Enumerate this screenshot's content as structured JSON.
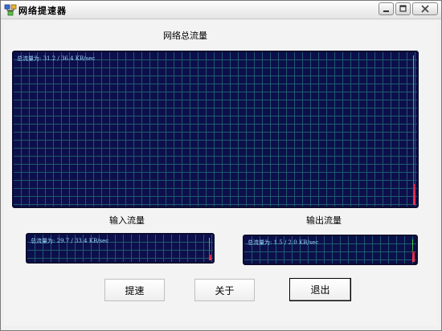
{
  "window": {
    "title": "网络提速器"
  },
  "total_traffic": {
    "label": "网络总流量",
    "rate_text": "总流量为: 31.2 / 36.4 KB/sec",
    "meter_level": 0.14
  },
  "input_traffic": {
    "label": "输入流量",
    "rate_text": "总流量为: 29.7 / 33.4 KB/sec",
    "meter_level": 0.25
  },
  "output_traffic": {
    "label": "输出流量",
    "rate_text": "总流量为: 1.5 / 2.0 KB/sec",
    "meter_level": 0.45
  },
  "buttons": {
    "speed_up": "提速",
    "about": "关于",
    "exit": "退出"
  },
  "colors": {
    "graph_background": "#0c0f4c",
    "grid_lines": "#1f5a6a",
    "rate_text": "#9cd6ff",
    "meter_green": "#39e33b",
    "meter_red": "#ff3350"
  }
}
